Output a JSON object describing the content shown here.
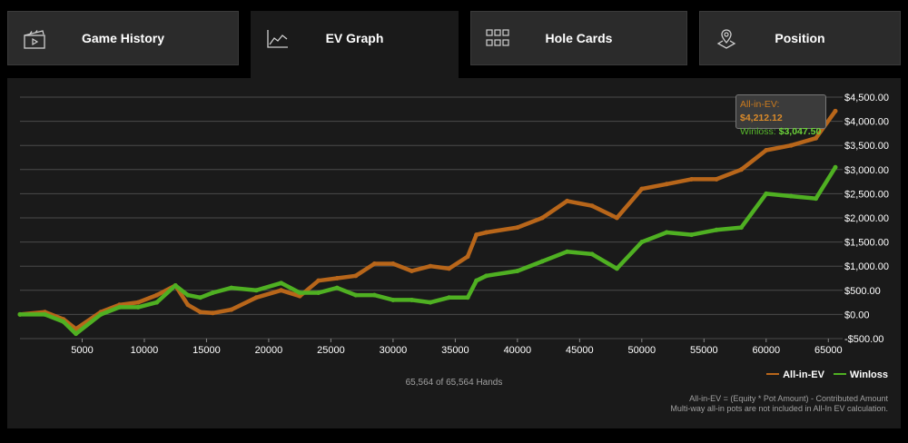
{
  "tabs": [
    {
      "label": "Game History",
      "icon": "clapperboard-icon",
      "active": false
    },
    {
      "label": "EV Graph",
      "icon": "line-chart-icon",
      "active": true
    },
    {
      "label": "Hole Cards",
      "icon": "grid-icon",
      "active": false
    },
    {
      "label": "Position",
      "icon": "map-pin-icon",
      "active": false
    }
  ],
  "tooltip": {
    "ev_key": "All-in-EV:",
    "ev_value": "$4,212.12",
    "win_key": "Winloss:",
    "win_value": "$3,047.50"
  },
  "hands_label": "65,564 of 65,564 Hands",
  "legend": {
    "ev": "All-in-EV",
    "winloss": "Winloss"
  },
  "footnote": {
    "line1": "All-in-EV = (Equity * Pot Amount) - Contributed Amount",
    "line2": "Multi-way all-in pots are not included in All-In EV calculation."
  },
  "colors": {
    "ev": "#b8661a",
    "winloss": "#4fb022",
    "grid": "#4a4a4a",
    "panel": "#1a1a1a"
  },
  "chart_data": {
    "type": "line",
    "y_ticks": [
      "$4,500.00",
      "$4,000.00",
      "$3,500.00",
      "$3,000.00",
      "$2,500.00",
      "$2,000.00",
      "$1,500.00",
      "$1,000.00",
      "$500.00",
      "$0.00",
      "-$500.00"
    ],
    "x_ticks": [
      "5000",
      "10000",
      "15000",
      "20000",
      "25000",
      "30000",
      "35000",
      "40000",
      "45000",
      "50000",
      "55000",
      "60000",
      "65000"
    ],
    "ylim": [
      -500,
      4500
    ],
    "xlim": [
      0,
      65564
    ],
    "series": [
      {
        "name": "All-in-EV",
        "color": "#b8661a",
        "x": [
          0,
          2000,
          3500,
          4500,
          6500,
          8000,
          9500,
          11000,
          12500,
          13500,
          14500,
          15500,
          17000,
          19000,
          21000,
          22500,
          24000,
          25500,
          27000,
          28500,
          30000,
          31500,
          33000,
          34500,
          36000,
          36700,
          37500,
          40000,
          42000,
          44000,
          46000,
          48000,
          50000,
          52000,
          54000,
          56000,
          58000,
          60000,
          62000,
          64000,
          65564
        ],
        "y": [
          0,
          50,
          -100,
          -300,
          50,
          200,
          250,
          400,
          600,
          200,
          50,
          30,
          100,
          350,
          500,
          380,
          700,
          750,
          800,
          1050,
          1050,
          900,
          1000,
          950,
          1200,
          1650,
          1700,
          1800,
          2000,
          2350,
          2250,
          2000,
          2600,
          2700,
          2800,
          2800,
          3000,
          3400,
          3500,
          3650,
          4212
        ]
      },
      {
        "name": "Winloss",
        "color": "#4fb022",
        "x": [
          0,
          2000,
          3500,
          4500,
          6500,
          8000,
          9500,
          11000,
          12500,
          13500,
          14500,
          15500,
          17000,
          19000,
          21000,
          22500,
          24000,
          25500,
          27000,
          28500,
          30000,
          31500,
          33000,
          34500,
          36000,
          36700,
          37500,
          40000,
          42000,
          44000,
          46000,
          48000,
          50000,
          52000,
          54000,
          56000,
          58000,
          60000,
          62000,
          64000,
          65564
        ],
        "y": [
          0,
          0,
          -150,
          -400,
          0,
          150,
          150,
          250,
          600,
          400,
          350,
          450,
          550,
          500,
          650,
          450,
          450,
          550,
          400,
          400,
          300,
          300,
          250,
          350,
          350,
          700,
          800,
          900,
          1100,
          1300,
          1250,
          950,
          1500,
          1700,
          1650,
          1750,
          1800,
          2500,
          2450,
          2400,
          3047
        ]
      }
    ]
  }
}
